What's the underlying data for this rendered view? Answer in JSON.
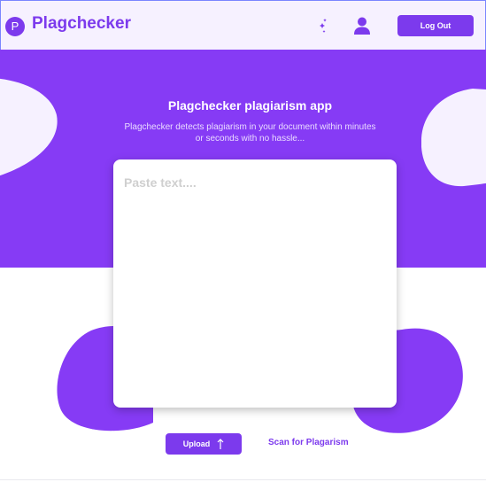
{
  "header": {
    "logo_letter": "P",
    "brand": "Plagchecker",
    "theme_icon": "moon-stars-icon",
    "user_icon": "user-icon",
    "logout_label": "Log Out"
  },
  "hero": {
    "title": "Plagchecker plagiarism app",
    "subtitle": "Plagchecker detects plagiarism in your document within minutes or seconds  with no hassle..."
  },
  "editor": {
    "placeholder": "Paste text...."
  },
  "actions": {
    "upload_label": "Upload",
    "upload_icon": "arrow-up-icon",
    "scan_label": "Scan for Plagarism"
  },
  "colors": {
    "accent": "#7c3aed",
    "hero_bg": "#863bf5",
    "header_bg": "#f6f1ff"
  }
}
